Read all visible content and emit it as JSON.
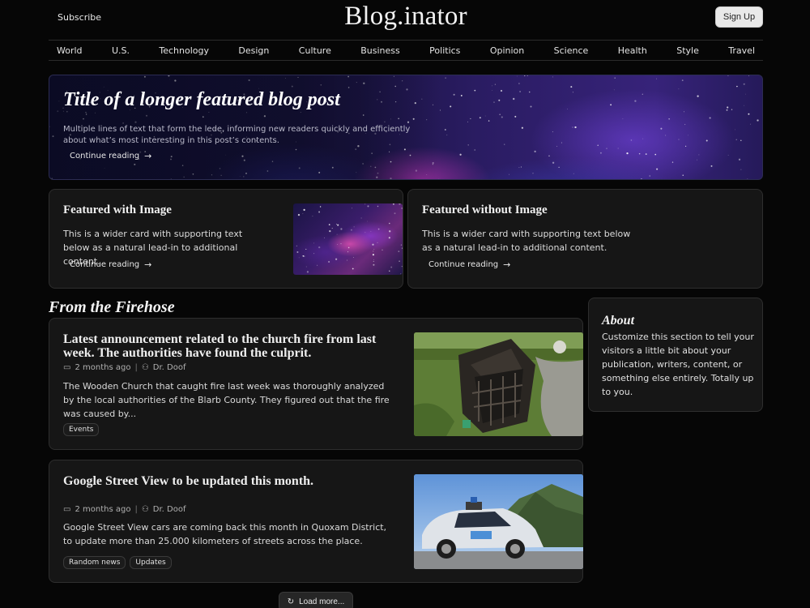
{
  "header": {
    "subscribe": "Subscribe",
    "brand": "Blog.inator",
    "signup": "Sign Up"
  },
  "nav": [
    "World",
    "U.S.",
    "Technology",
    "Design",
    "Culture",
    "Business",
    "Politics",
    "Opinion",
    "Science",
    "Health",
    "Style",
    "Travel"
  ],
  "hero": {
    "title": "Title of a longer featured blog post",
    "lede": "Multiple lines of text that form the lede, informing new readers quickly and efficiently about what’s most interesting in this post’s contents.",
    "link": "Continue reading"
  },
  "featured": [
    {
      "title": "Featured with Image",
      "text": "This is a wider card with supporting text below as a natural lead-in to additional content.",
      "link": "Continue reading"
    },
    {
      "title": "Featured without Image",
      "text": "This is a wider card with supporting text below as a natural lead-in to additional content.",
      "link": "Continue reading"
    }
  ],
  "firehose": {
    "title": "From the Firehose",
    "posts": [
      {
        "title": "Latest announcement related to the church fire from last week. The authorities have found the culprit.",
        "date": "2 months ago",
        "author": "Dr. Doof",
        "text": "The Wooden Church that caught fire last week was thoroughly analyzed by the local authorities of the Blarb County. They figured out that the fire was caused by...",
        "tags": [
          "Events"
        ]
      },
      {
        "title": "Google Street View to be updated this month.",
        "date": "2 months ago",
        "author": "Dr. Doof",
        "text": "Google Street View cars are coming back this month in Quoxam District, to update more than 25.000 kilometers of streets across the place.",
        "tags": [
          "Random news",
          "Updates"
        ]
      }
    ],
    "load_more": "Load more..."
  },
  "about": {
    "title": "About",
    "text": "Customize this section to tell your visitors a little bit about your publication, writers, content, or something else entirely. Totally up to you."
  },
  "icons": {
    "arrow": "arrow-right-icon",
    "calendar": "calendar-icon",
    "user": "user-icon",
    "reload": "reload-icon"
  }
}
